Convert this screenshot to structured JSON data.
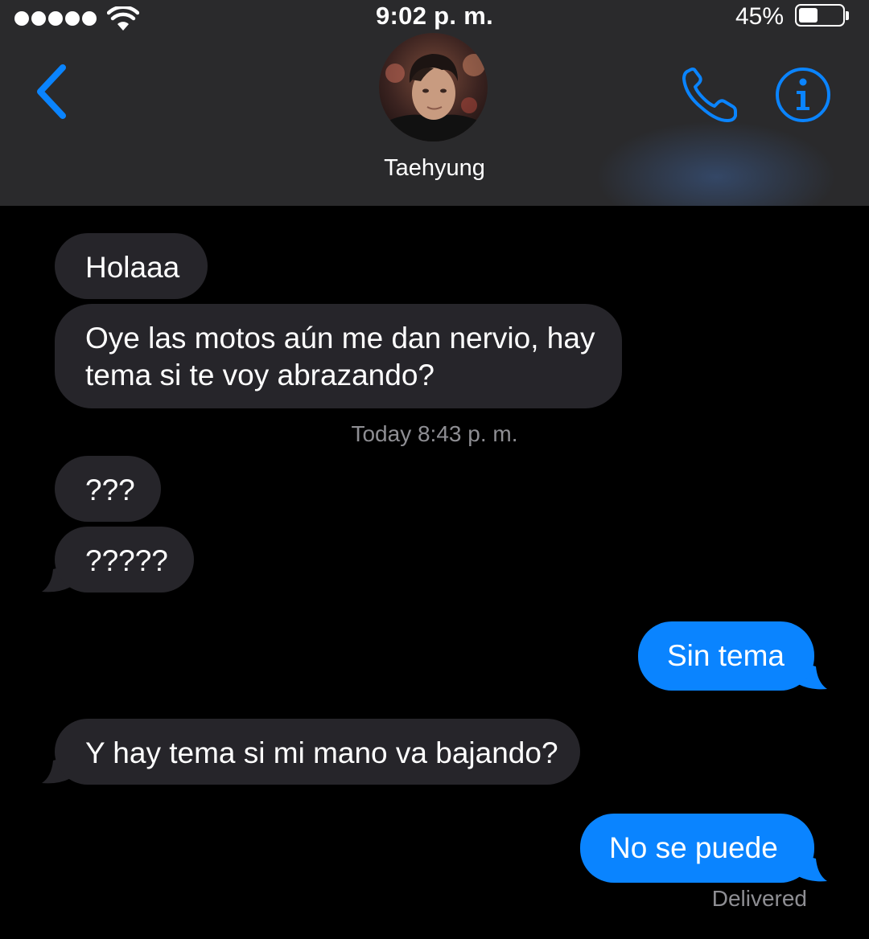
{
  "status_bar": {
    "time": "9:02 p. m.",
    "battery_percent": "45%",
    "battery_level": 0.45,
    "signal_bars": 5,
    "signal-icon": "signal-dots-icon",
    "wifi-icon": "wifi-icon"
  },
  "header": {
    "contact_name": "Taehyung",
    "back_icon": "chevron-left-icon",
    "call_icon": "phone-icon",
    "info_icon": "info-icon",
    "accent_color": "#0a84ff"
  },
  "conversation": {
    "messages": [
      {
        "direction": "incoming",
        "text": "Holaaa"
      },
      {
        "direction": "incoming",
        "text_line1": "Oye las motos aún me dan nervio, hay",
        "text_line2": "tema si te voy abrazando?"
      },
      {
        "direction": "incoming",
        "text": "???"
      },
      {
        "direction": "incoming",
        "text": "?????"
      },
      {
        "direction": "outgoing",
        "text": "Sin tema"
      },
      {
        "direction": "incoming",
        "text": "Y hay tema si mi mano va bajando?"
      },
      {
        "direction": "outgoing",
        "text": "No se puede"
      }
    ],
    "timestamp": "Today 8:43 p. m.",
    "delivered_label": "Delivered",
    "incoming_color": "#26252a",
    "outgoing_color": "#0a84ff"
  }
}
